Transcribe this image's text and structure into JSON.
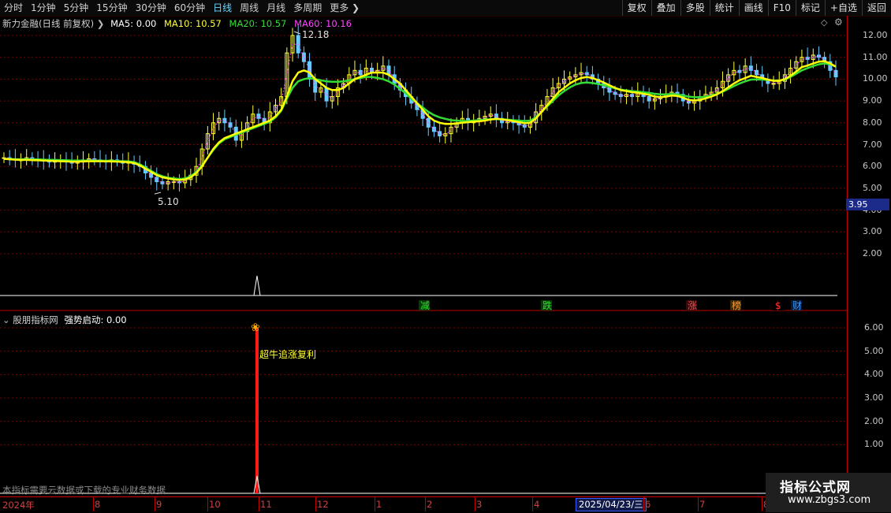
{
  "toolbar": {
    "periods": [
      "分时",
      "1分钟",
      "5分钟",
      "15分钟",
      "30分钟",
      "60分钟",
      "日线",
      "周线",
      "月线",
      "多周期",
      "更多"
    ],
    "active_period": "日线",
    "buttons": [
      "复权",
      "叠加",
      "多股",
      "统计",
      "画线",
      "F10",
      "标记",
      "+自选",
      "返回"
    ]
  },
  "main_panel": {
    "title": "新力金融(日线 前复权)",
    "ma5": "MA5: 0.00",
    "ma10": "MA10: 10.57",
    "ma20": "MA20: 10.57",
    "ma60": "MA60: 10.16",
    "high_label": "12.18",
    "low_label": "5.10",
    "current_price_tag": "3.95",
    "y_ticks": [
      "12.00",
      "11.00",
      "10.00",
      "9.00",
      "8.00",
      "7.00",
      "6.00",
      "5.00",
      "4.00",
      "3.00",
      "2.00"
    ],
    "event_badges": [
      "减",
      "跌",
      "涨",
      "榜",
      "$",
      "财"
    ]
  },
  "indicator_panel": {
    "title": "股朋指标网",
    "value": "强势启动: 0.00",
    "signal_label": "超牛追涨复利",
    "y_ticks": [
      "6.00",
      "5.00",
      "4.00",
      "3.00",
      "2.00",
      "1.00"
    ]
  },
  "date_axis": {
    "year_label": "2024年",
    "months": [
      "8",
      "9",
      "10",
      "11",
      "12",
      "1",
      "2",
      "3",
      "4",
      "6",
      "7",
      "8"
    ],
    "cursor_date": "2025/04/23/三"
  },
  "footer_note": "本指标需要云数据或下载的专业财务数据",
  "watermark": {
    "line1": "指标公式网",
    "line2": "www.zbgs3.com"
  },
  "colors": {
    "up": "#ffff33",
    "down": "#66ccff",
    "ma_yellow": "#ffff00",
    "ma_green": "#33dd33",
    "ma_magenta": "#ff44ff",
    "grid": "#7a0000",
    "axis": "#c00000"
  },
  "chart_data": {
    "type": "candlestick",
    "close": [
      6.4,
      6.35,
      6.3,
      6.3,
      6.4,
      6.35,
      6.3,
      6.25,
      6.2,
      6.25,
      6.3,
      6.2,
      6.15,
      6.2,
      6.3,
      6.35,
      6.3,
      6.25,
      6.2,
      6.3,
      6.25,
      6.15,
      6.2,
      6.1,
      6.0,
      5.7,
      5.5,
      5.3,
      5.2,
      5.3,
      5.3,
      5.25,
      5.4,
      5.6,
      6.0,
      6.8,
      7.5,
      8.0,
      8.2,
      8.0,
      7.8,
      7.2,
      7.6,
      8.0,
      8.4,
      8.2,
      8.0,
      8.5,
      8.8,
      9.2,
      11.2,
      12.0,
      11.2,
      10.8,
      10.0,
      9.4,
      9.6,
      9.0,
      9.2,
      9.6,
      9.8,
      10.2,
      10.4,
      10.2,
      10.5,
      10.3,
      10.4,
      10.6,
      10.2,
      9.8,
      9.5,
      9.2,
      8.9,
      8.6,
      8.2,
      7.8,
      7.6,
      7.4,
      7.5,
      7.8,
      8.0,
      8.2,
      8.0,
      8.1,
      8.2,
      8.3,
      8.4,
      8.2,
      8.0,
      8.1,
      8.0,
      7.9,
      7.8,
      8.0,
      8.5,
      8.8,
      9.2,
      9.6,
      9.8,
      10.0,
      10.1,
      10.2,
      10.3,
      10.2,
      10.0,
      9.8,
      9.6,
      9.4,
      9.3,
      9.2,
      9.3,
      9.2,
      9.4,
      9.2,
      9.0,
      9.1,
      9.2,
      9.3,
      9.4,
      9.3,
      9.0,
      8.9,
      9.0,
      9.2,
      9.3,
      9.4,
      9.6,
      9.9,
      10.2,
      10.4,
      10.3,
      10.6,
      10.4,
      10.2,
      10.0,
      9.8,
      9.8,
      9.9,
      10.2,
      10.5,
      10.8,
      11.0,
      10.9,
      11.1,
      11.0,
      10.8,
      10.4,
      10.1
    ],
    "ma_yellow": [
      6.35,
      6.33,
      6.31,
      6.3,
      6.3,
      6.29,
      6.28,
      6.27,
      6.26,
      6.25,
      6.24,
      6.23,
      6.22,
      6.22,
      6.23,
      6.24,
      6.24,
      6.24,
      6.23,
      6.23,
      6.22,
      6.21,
      6.2,
      6.15,
      6.05,
      5.9,
      5.75,
      5.6,
      5.5,
      5.45,
      5.4,
      5.38,
      5.4,
      5.5,
      5.7,
      6.0,
      6.4,
      6.8,
      7.1,
      7.3,
      7.4,
      7.5,
      7.6,
      7.7,
      7.8,
      7.9,
      8.0,
      8.1,
      8.3,
      8.6,
      9.2,
      9.9,
      10.3,
      10.4,
      10.3,
      10.0,
      9.8,
      9.6,
      9.5,
      9.5,
      9.6,
      9.8,
      10.0,
      10.1,
      10.2,
      10.3,
      10.3,
      10.3,
      10.2,
      10.0,
      9.8,
      9.5,
      9.2,
      8.9,
      8.6,
      8.3,
      8.1,
      8.0,
      7.95,
      7.95,
      7.97,
      8.0,
      8.03,
      8.05,
      8.07,
      8.1,
      8.15,
      8.18,
      8.16,
      8.12,
      8.08,
      8.03,
      7.98,
      8.0,
      8.2,
      8.5,
      8.8,
      9.1,
      9.4,
      9.6,
      9.8,
      9.95,
      10.05,
      10.1,
      10.05,
      9.95,
      9.85,
      9.72,
      9.6,
      9.5,
      9.45,
      9.4,
      9.38,
      9.33,
      9.28,
      9.2,
      9.18,
      9.2,
      9.25,
      9.23,
      9.15,
      9.05,
      9.02,
      9.05,
      9.12,
      9.2,
      9.3,
      9.45,
      9.62,
      9.8,
      9.95,
      10.05,
      10.15,
      10.1,
      10.05,
      9.98,
      9.92,
      9.92,
      10.0,
      10.15,
      10.35,
      10.55,
      10.62,
      10.72,
      10.8,
      10.82,
      10.72,
      10.57
    ],
    "ma_green": [
      6.35,
      6.34,
      6.33,
      6.33,
      6.33,
      6.32,
      6.32,
      6.31,
      6.3,
      6.3,
      6.29,
      6.28,
      6.27,
      6.27,
      6.27,
      6.27,
      6.27,
      6.26,
      6.26,
      6.26,
      6.25,
      6.24,
      6.23,
      6.2,
      6.1,
      5.95,
      5.8,
      5.65,
      5.55,
      5.48,
      5.45,
      5.42,
      5.45,
      5.55,
      5.75,
      6.05,
      6.4,
      6.75,
      7.05,
      7.25,
      7.35,
      7.45,
      7.55,
      7.65,
      7.75,
      7.85,
      7.95,
      8.05,
      8.25,
      8.55,
      9.1,
      9.6,
      9.9,
      10.0,
      10.05,
      10.0,
      9.95,
      9.9,
      9.88,
      9.88,
      9.9,
      9.95,
      10.0,
      10.05,
      10.1,
      10.1,
      10.05,
      10.0,
      9.9,
      9.75,
      9.55,
      9.35,
      9.1,
      8.9,
      8.7,
      8.5,
      8.35,
      8.25,
      8.18,
      8.12,
      8.1,
      8.08,
      8.08,
      8.1,
      8.12,
      8.14,
      8.16,
      8.17,
      8.16,
      8.14,
      8.12,
      8.1,
      8.08,
      8.1,
      8.25,
      8.5,
      8.75,
      9.0,
      9.25,
      9.45,
      9.62,
      9.75,
      9.82,
      9.85,
      9.82,
      9.78,
      9.72,
      9.65,
      9.58,
      9.52,
      9.48,
      9.45,
      9.43,
      9.4,
      9.37,
      9.33,
      9.3,
      9.3,
      9.32,
      9.3,
      9.25,
      9.2,
      9.17,
      9.17,
      9.2,
      9.25,
      9.32,
      9.42,
      9.55,
      9.68,
      9.8,
      9.9,
      9.98,
      9.99,
      9.98,
      9.96,
      9.94,
      9.94,
      9.98,
      10.1,
      10.25,
      10.4,
      10.5,
      10.6,
      10.68,
      10.72,
      10.68,
      10.57
    ],
    "signal_index": 45,
    "signal_value": 6.0,
    "ylim_main": [
      1.0,
      12.5
    ],
    "ylim_indicator": [
      0,
      6.5
    ]
  }
}
